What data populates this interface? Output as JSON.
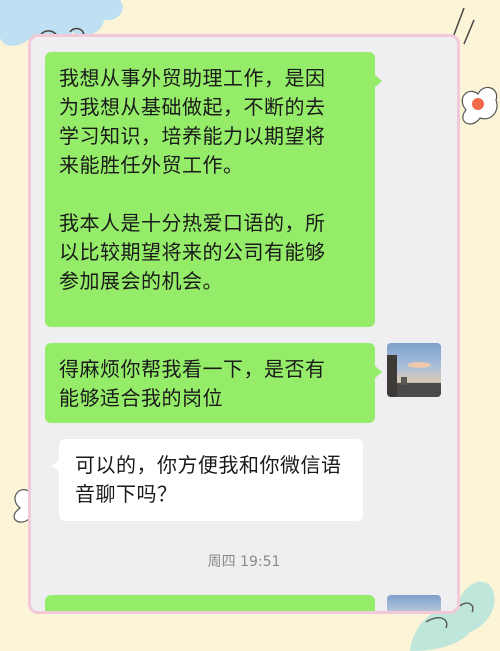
{
  "colors": {
    "background": "#fbf4d6",
    "frame_border": "#f2c9d8",
    "chat_background": "#efeff2",
    "sent_bubble": "#95ec69",
    "received_bubble": "#ffffff"
  },
  "messages": [
    {
      "direction": "sent",
      "paragraphs": [
        [
          "我想从事外贸助理工作，是因",
          "为我想从基础做起，不断的去",
          "学习知识，培养能力以期望将",
          "来能胜任外贸工作。"
        ],
        [
          "我本人是十分热爱口语的，所",
          "以比较期望将来的公司有能够",
          "参加展会的机会。"
        ]
      ]
    },
    {
      "direction": "sent",
      "lines": [
        "得麻烦你帮我看一下，是否有",
        "能够适合我的岗位"
      ]
    },
    {
      "direction": "received",
      "lines": [
        "可以的，你方便我和你微信语",
        "音聊下吗？"
      ]
    }
  ],
  "timestamp": "周四 19:51"
}
